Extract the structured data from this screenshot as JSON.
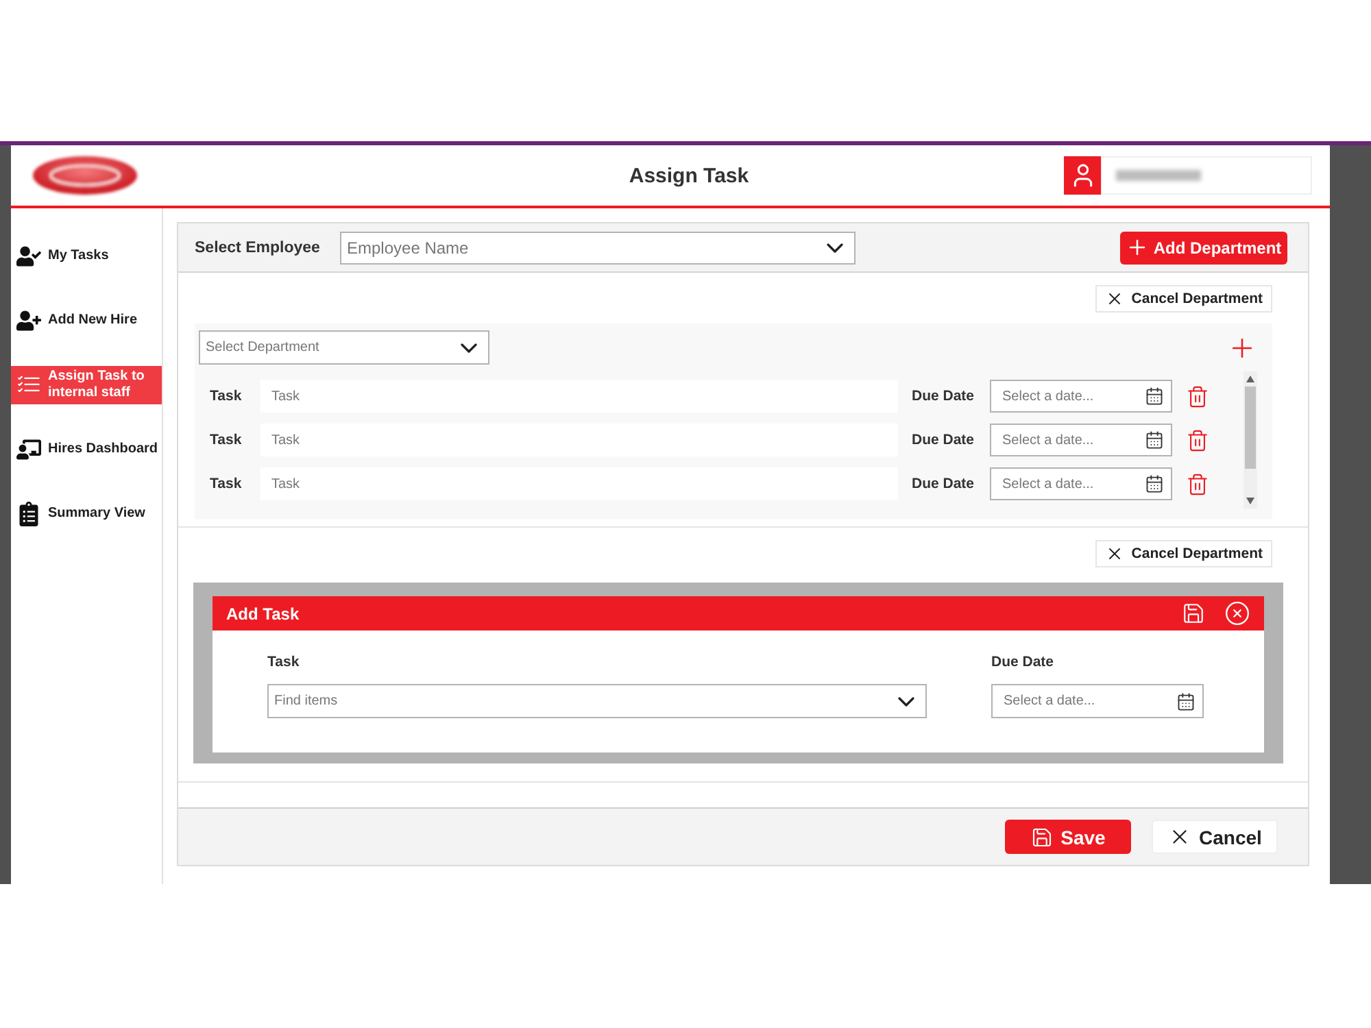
{
  "header": {
    "title": "Assign Task"
  },
  "sidebar": {
    "items": [
      {
        "label": "My Tasks",
        "selected": false
      },
      {
        "label": "Add New Hire",
        "selected": false
      },
      {
        "label": "Assign Task to internal staff",
        "selected": true
      },
      {
        "label": "Hires Dashboard",
        "selected": false
      },
      {
        "label": "Summary View",
        "selected": false
      }
    ]
  },
  "employee_bar": {
    "label": "Select Employee",
    "employee_field": {
      "placeholder": "Employee Name"
    },
    "add_button": "Add Department"
  },
  "departments": [
    {
      "cancel_button": "Cancel Department",
      "department_field": {
        "placeholder": "Select Department"
      },
      "tasks": [
        {
          "label": "Task",
          "task_field": {
            "placeholder": "Task"
          },
          "due_label": "Due Date",
          "date_field": {
            "placeholder": "Select a date..."
          }
        },
        {
          "label": "Task",
          "task_field": {
            "placeholder": "Task"
          },
          "due_label": "Due Date",
          "date_field": {
            "placeholder": "Select a date..."
          }
        },
        {
          "label": "Task",
          "task_field": {
            "placeholder": "Task"
          },
          "due_label": "Due Date",
          "date_field": {
            "placeholder": "Select a date..."
          }
        }
      ]
    },
    {
      "cancel_button": "Cancel Department",
      "dialog": {
        "title": "Add Task",
        "task_label": "Task",
        "task_field": {
          "placeholder": "Find items"
        },
        "due_label": "Due Date",
        "date_field": {
          "placeholder": "Select a date..."
        }
      }
    }
  ],
  "footer": {
    "buttons": [
      {
        "label": "Save",
        "kind": "primary"
      },
      {
        "label": "Cancel",
        "kind": "secondary"
      }
    ]
  }
}
